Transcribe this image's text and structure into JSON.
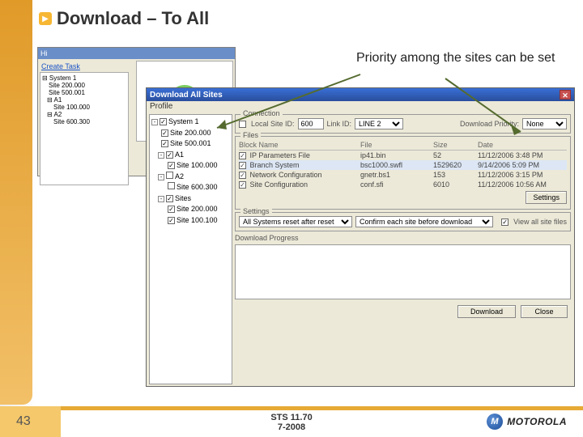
{
  "slide": {
    "title": "Download – To All",
    "annotation": "Priority among the sites can be set",
    "page_num": "43",
    "footer_line1": "STS 11.70",
    "footer_line2": "7-2008",
    "brand": "MOTOROLA"
  },
  "back_window": {
    "link": "Create Task",
    "tree": [
      "System 1",
      "Site 200.000",
      "Site 500.001",
      "A1",
      "Site 100.000",
      "A2",
      "Site 600.300"
    ]
  },
  "dialog": {
    "title": "Download All Sites",
    "menu": "Profile",
    "tree": [
      {
        "exp": "-",
        "chk": "✓",
        "label": "System 1"
      },
      {
        "pad": 12,
        "chk": "✓",
        "label": "Site 200.000"
      },
      {
        "pad": 12,
        "chk": "✓",
        "label": "Site 500.001"
      },
      {
        "pad": 8,
        "exp": "-",
        "chk": "✓",
        "label": "A1"
      },
      {
        "pad": 20,
        "chk": "✓",
        "label": "Site 100.000"
      },
      {
        "pad": 8,
        "exp": "-",
        "chk": " ",
        "label": "A2"
      },
      {
        "pad": 20,
        "chk": " ",
        "label": "Site 600.300"
      },
      {
        "pad": 8,
        "exp": "-",
        "chk": "✓",
        "label": "Sites"
      },
      {
        "pad": 20,
        "chk": "✓",
        "label": "Site 200.000"
      },
      {
        "pad": 20,
        "chk": "✓",
        "label": "Site 100.100"
      }
    ],
    "conn": {
      "group": "Connection",
      "local_label": "Local  Site ID:",
      "siteid": "600",
      "linkid_label": "Link ID:",
      "linkid": "LINE 2",
      "priority_label": "Download Priority:",
      "priority": "None"
    },
    "files": {
      "group": "Files",
      "headers": [
        "Block Name",
        "File",
        "Size",
        "Date"
      ],
      "rows": [
        {
          "chk": "✓",
          "name": "IP Parameters File",
          "file": "ip41.bin",
          "size": "52",
          "date": "11/12/2006 3:48 PM"
        },
        {
          "chk": "✓",
          "name": "Branch System",
          "file": "bsc1000.swfl",
          "size": "1529620",
          "date": "9/14/2006 5:09 PM",
          "hl": true
        },
        {
          "chk": "✓",
          "name": "Network Configuration",
          "file": "gnetr.bs1",
          "size": "153",
          "date": "11/12/2006 3:15 PM"
        },
        {
          "chk": "✓",
          "name": "Site Configuration",
          "file": "conf.sfi",
          "size": "6010",
          "date": "11/12/2006 10:56 AM"
        }
      ],
      "settings_btn": "Settings"
    },
    "settings": {
      "group": "Settings",
      "opt1": "All Systems reset after reset",
      "opt2": "Confirm each site before download",
      "view_all": "View all site files"
    },
    "progress_label": "Download Progress",
    "download": "Download",
    "close": "Close"
  }
}
